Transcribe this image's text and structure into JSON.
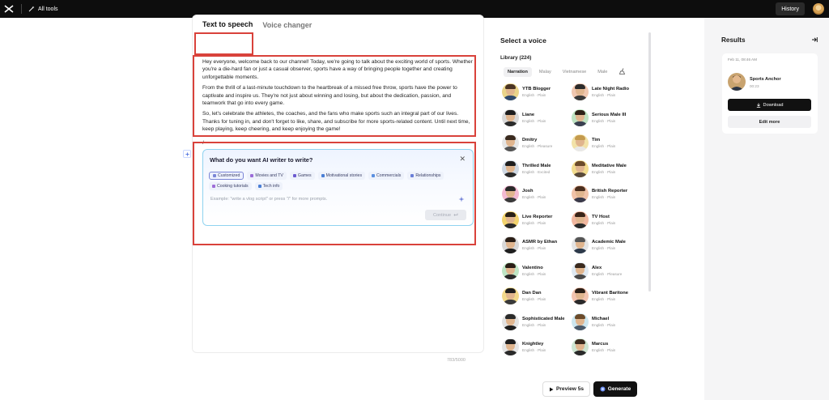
{
  "topbar": {
    "all_tools_label": "All tools",
    "history_label": "History"
  },
  "editor": {
    "tabs": [
      {
        "label": "Text to speech",
        "active": true
      },
      {
        "label": "Voice changer",
        "active": false
      }
    ],
    "paragraphs": [
      "Hey everyone, welcome back to our channel! Today, we're going to talk about the exciting world of sports. Whether you're a die-hard fan or just a casual observer, sports have a way of bringing people together and creating unforgettable moments.",
      "From the thrill of a last-minute touchdown to the heartbreak of a missed free throw, sports have the power to captivate and inspire us. They're not just about winning and losing, but about the dedication, passion, and teamwork that go into every game.",
      "So, let's celebrate the athletes, the coaches, and the fans who make sports such an integral part of our lives. Thanks for tuning in, and don't forget to like, share, and subscribe for more sports-related content. Until next time, keep playing, keep cheering, and keep enjoying the game!"
    ],
    "slash_text": "/",
    "char_count": "783/5000"
  },
  "ai_writer": {
    "title": "What do you want AI writer to write?",
    "close_glyph": "✕",
    "chips": [
      {
        "label": "Customized",
        "selected": true,
        "color": "#7b86d6"
      },
      {
        "label": "Movies and TV",
        "selected": false,
        "color": "#9b6cd9"
      },
      {
        "label": "Games",
        "selected": false,
        "color": "#6c5bd0"
      },
      {
        "label": "Motivational stories",
        "selected": false,
        "color": "#4a7fd6"
      },
      {
        "label": "Commercials",
        "selected": false,
        "color": "#5a8fe0"
      },
      {
        "label": "Relationships",
        "selected": false,
        "color": "#6a7fd8"
      },
      {
        "label": "Cooking tutorials",
        "selected": false,
        "color": "#9f6ed8"
      },
      {
        "label": "Tech info",
        "selected": false,
        "color": "#4a7fd6"
      }
    ],
    "placeholder": "Example: \"write a vlog script\" or press \"/\" for more prompts.",
    "continue_label": "Continue"
  },
  "voices": {
    "title": "Select a voice",
    "library_label": "Library (224)",
    "filters": [
      {
        "label": "Narration",
        "active": true
      },
      {
        "label": "Malay",
        "active": false
      },
      {
        "label": "Vietnamese",
        "active": false
      },
      {
        "label": "Male",
        "active": false
      }
    ],
    "items": [
      {
        "name": "YTB Blogger",
        "sub": "English · Plain",
        "bg": "#e9d48a",
        "hair": "#4a3424",
        "body": "#2f4a6e"
      },
      {
        "name": "Late Night Radio",
        "sub": "English · Plain",
        "bg": "#f0c7b0",
        "hair": "#2b2b2b",
        "body": "#3a3a3a"
      },
      {
        "name": "Liane",
        "sub": "English · Plain",
        "bg": "#d9d9d9",
        "hair": "#1d1d1d",
        "body": "#2b2b2b"
      },
      {
        "name": "Serious Male III",
        "sub": "English · Plain",
        "bg": "#bfe3c2",
        "hair": "#2d2016",
        "body": "#3a4050"
      },
      {
        "name": "Dmitry",
        "sub": "English · Pleasure",
        "bg": "#e5e5e5",
        "hair": "#3a2a1e",
        "body": "#555"
      },
      {
        "name": "Tim",
        "sub": "English · Plain",
        "bg": "#f2e2a8",
        "hair": "#c49a4e",
        "body": "#e8e8e8"
      },
      {
        "name": "Thrilled Male",
        "sub": "English · Excited",
        "bg": "#cfd8e3",
        "hair": "#1e1e1e",
        "body": "#2a2a2a"
      },
      {
        "name": "Meditative Male",
        "sub": "English · Plain",
        "bg": "#f2dc8e",
        "hair": "#6b4a2a",
        "body": "#5a4a3a"
      },
      {
        "name": "Josh",
        "sub": "English · Plain",
        "bg": "#f3b9d2",
        "hair": "#2a2a2a",
        "body": "#3a3a3a"
      },
      {
        "name": "British Reporter",
        "sub": "English · Plain",
        "bg": "#f0c2a8",
        "hair": "#4a2e1e",
        "body": "#3a3a4a"
      },
      {
        "name": "Live Reporter",
        "sub": "English · Plain",
        "bg": "#f2d36e",
        "hair": "#2a2016",
        "body": "#2a2a2a"
      },
      {
        "name": "TV Host",
        "sub": "English · Plain",
        "bg": "#f1b7a0",
        "hair": "#3a2418",
        "body": "#2b2b2b"
      },
      {
        "name": "ASMR by Ethan",
        "sub": "English · Plain",
        "bg": "#d8d8d8",
        "hair": "#2a1e16",
        "body": "#1f1f1f"
      },
      {
        "name": "Academic Male",
        "sub": "English · Plain",
        "bg": "#e4e4e4",
        "hair": "#555",
        "body": "#2d3a4a"
      },
      {
        "name": "Valentino",
        "sub": "English · Plain",
        "bg": "#bfe6c6",
        "hair": "#2a1e16",
        "body": "#2a2a2a"
      },
      {
        "name": "Alex",
        "sub": "English · Pleasure",
        "bg": "#dfe9f2",
        "hair": "#3a2a1e",
        "body": "#4a4a4a"
      },
      {
        "name": "Dan Dan",
        "sub": "English · Plain",
        "bg": "#f2d98a",
        "hair": "#1e1e1e",
        "body": "#3a3a3a"
      },
      {
        "name": "Vibrant Baritone",
        "sub": "English · Plain",
        "bg": "#f3c4b0",
        "hair": "#2a1e16",
        "body": "#2a2a2a"
      },
      {
        "name": "Sophisticated Male",
        "sub": "English · Plain",
        "bg": "#e2e2e2",
        "hair": "#2a2a2a",
        "body": "#1e1e1e"
      },
      {
        "name": "Michael",
        "sub": "English · Plain",
        "bg": "#cde6ef",
        "hair": "#6b4a2a",
        "body": "#4a5a6a"
      },
      {
        "name": "Knightley",
        "sub": "English · Plain",
        "bg": "#e6e6e6",
        "hair": "#1e1e1e",
        "body": "#2a2a2a"
      },
      {
        "name": "Marcus",
        "sub": "English · Plain",
        "bg": "#cfe6d2",
        "hair": "#3a2a1e",
        "body": "#2a2a2a"
      }
    ]
  },
  "bottom": {
    "preview_label": "Preview 5s",
    "generate_label": "Generate"
  },
  "results": {
    "title": "Results",
    "date": "Feb 11, 08:46 AM",
    "name": "Sports Anchor",
    "duration": "00:23",
    "download_label": "Download",
    "edit_label": "Edit more"
  }
}
